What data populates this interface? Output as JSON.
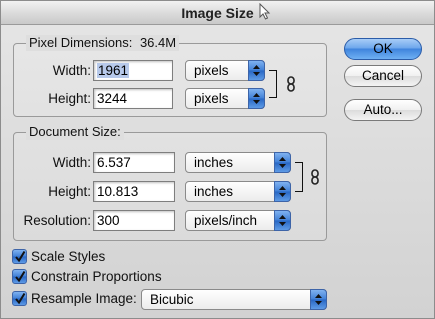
{
  "window": {
    "title": "Image Size"
  },
  "pixel_dimensions": {
    "label": "Pixel Dimensions:",
    "size": "36.4M",
    "width_label": "Width:",
    "width_value": "1961",
    "width_unit": "pixels",
    "height_label": "Height:",
    "height_value": "3244",
    "height_unit": "pixels"
  },
  "document_size": {
    "label": "Document Size:",
    "width_label": "Width:",
    "width_value": "6.537",
    "width_unit": "inches",
    "height_label": "Height:",
    "height_value": "10.813",
    "height_unit": "inches",
    "resolution_label": "Resolution:",
    "resolution_value": "300",
    "resolution_unit": "pixels/inch"
  },
  "buttons": {
    "ok": "OK",
    "cancel": "Cancel",
    "auto": "Auto..."
  },
  "options": {
    "scale_styles": "Scale Styles",
    "scale_styles_checked": true,
    "constrain_proportions": "Constrain Proportions",
    "constrain_proportions_checked": true,
    "resample_image": "Resample Image:",
    "resample_image_checked": true,
    "resample_method": "Bicubic"
  },
  "colors": {
    "accent": "#3f7fd6",
    "selection": "#b7c9ea"
  }
}
